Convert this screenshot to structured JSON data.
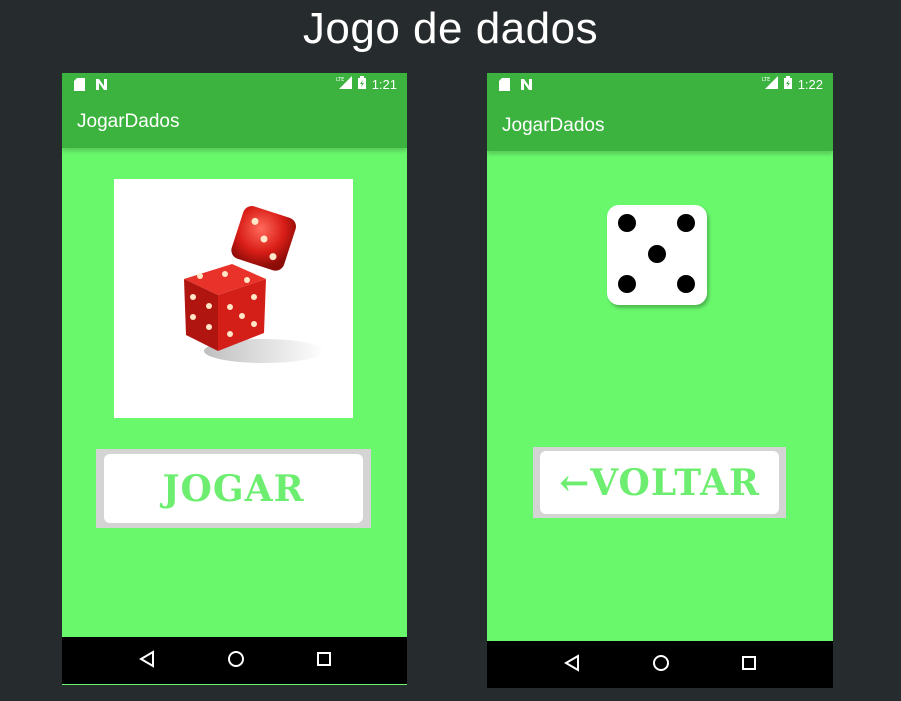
{
  "page": {
    "title": "Jogo de dados"
  },
  "phone1": {
    "status_time": "1:21",
    "app_title": "JogarDados",
    "play_button_label": "JOGAR"
  },
  "phone2": {
    "status_time": "1:22",
    "app_title": "JogarDados",
    "back_button_label": "←VOLTAR",
    "die_value": 5
  },
  "icons": {
    "status_left": [
      "sd-card-icon",
      "n-notification-icon"
    ],
    "status_right": [
      "lte-signal-icon",
      "battery-icon"
    ],
    "nav": [
      "back-triangle-icon",
      "home-circle-icon",
      "recents-square-icon"
    ]
  },
  "colors": {
    "background": "#262b2e",
    "app_bar": "#3bb33e",
    "screen": "#69f76c",
    "button_text": "#6eee70",
    "nav_bar": "#000000"
  }
}
